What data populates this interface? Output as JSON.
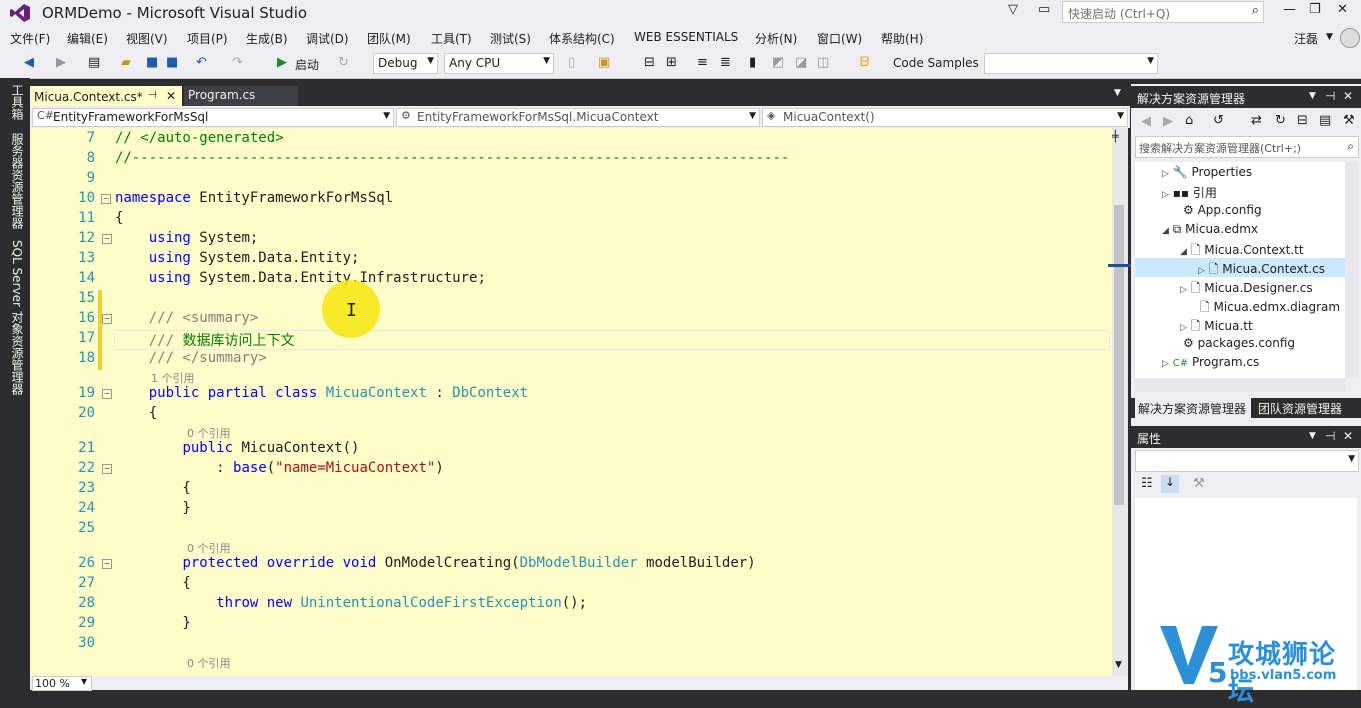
{
  "window": {
    "title": "ORMDemo - Microsoft Visual Studio",
    "quick_launch_placeholder": "快速启动 (Ctrl+Q)",
    "user": "汪磊"
  },
  "menu": [
    "文件(F)",
    "编辑(E)",
    "视图(V)",
    "项目(P)",
    "生成(B)",
    "调试(D)",
    "团队(M)",
    "工具(T)",
    "测试(S)",
    "体系结构(C)",
    "WEB ESSENTIALS",
    "分析(N)",
    "窗口(W)",
    "帮助(H)"
  ],
  "toolbar": {
    "start_label": "启动",
    "config": "Debug",
    "platform": "Any CPU",
    "code_samples": "Code Samples"
  },
  "left_rail": [
    "工具箱",
    "服务器资源管理器",
    "SQL Server 对象资源管理器"
  ],
  "tabs": [
    {
      "label": "Micua.Context.cs*",
      "active": true
    },
    {
      "label": "Program.cs",
      "active": false
    }
  ],
  "nav": {
    "project": "EntityFrameworkForMsSql",
    "type": "EntityFrameworkForMsSql.MicuaContext",
    "member": "MicuaContext()"
  },
  "code": {
    "lines": [
      {
        "n": "7",
        "t": "// </auto-generated>"
      },
      {
        "n": "8",
        "t": "//------------------------------------------------------------------------------"
      },
      {
        "n": "9",
        "t": ""
      },
      {
        "n": "10",
        "t": "namespace EntityFrameworkForMsSql"
      },
      {
        "n": "11",
        "t": "{"
      },
      {
        "n": "12",
        "t": "    using System;"
      },
      {
        "n": "13",
        "t": "    using System.Data.Entity;"
      },
      {
        "n": "14",
        "t": "    using System.Data.Entity.Infrastructure;"
      },
      {
        "n": "15",
        "t": ""
      },
      {
        "n": "16",
        "t": "    /// <summary>"
      },
      {
        "n": "17",
        "t": "    /// 数据库访问上下文"
      },
      {
        "n": "18",
        "t": "    /// </summary>"
      },
      {
        "n": "19",
        "t": "    public partial class MicuaContext : DbContext"
      },
      {
        "n": "20",
        "t": "    {"
      },
      {
        "n": "21",
        "t": "        public MicuaContext()"
      },
      {
        "n": "22",
        "t": "            : base(\"name=MicuaContext\")"
      },
      {
        "n": "23",
        "t": "        {"
      },
      {
        "n": "24",
        "t": "        }"
      },
      {
        "n": "25",
        "t": ""
      },
      {
        "n": "26",
        "t": "        protected override void OnModelCreating(DbModelBuilder modelBuilder)"
      },
      {
        "n": "27",
        "t": "        {"
      },
      {
        "n": "28",
        "t": "            throw new UnintentionalCodeFirstException();"
      },
      {
        "n": "29",
        "t": "        }"
      },
      {
        "n": "30",
        "t": ""
      }
    ],
    "ref_1": "1 个引用",
    "ref_0": "0 个引用"
  },
  "zoom": "100 %",
  "solution_explorer": {
    "title": "解决方案资源管理器",
    "search_placeholder": "搜索解决方案资源管理器(Ctrl+;)",
    "items": [
      {
        "label": "Properties"
      },
      {
        "label": "引用"
      },
      {
        "label": "App.config"
      },
      {
        "label": "Micua.edmx"
      },
      {
        "label": "Micua.Context.tt"
      },
      {
        "label": "Micua.Context.cs"
      },
      {
        "label": "Micua.Designer.cs"
      },
      {
        "label": "Micua.edmx.diagram"
      },
      {
        "label": "Micua.tt"
      },
      {
        "label": "packages.config"
      },
      {
        "label": "Program.cs"
      }
    ],
    "tab_solution": "解决方案资源管理器",
    "tab_team": "团队资源管理器"
  },
  "properties": {
    "title": "属性"
  },
  "watermark": {
    "brand": "攻城狮论坛",
    "url": "bbs.vlan5.com"
  },
  "colors": {
    "editor_bg": "#fefcc8",
    "chrome_dark": "#2d2d30",
    "keyword": "#0000ff",
    "type": "#2b91af",
    "comment": "#008000"
  }
}
